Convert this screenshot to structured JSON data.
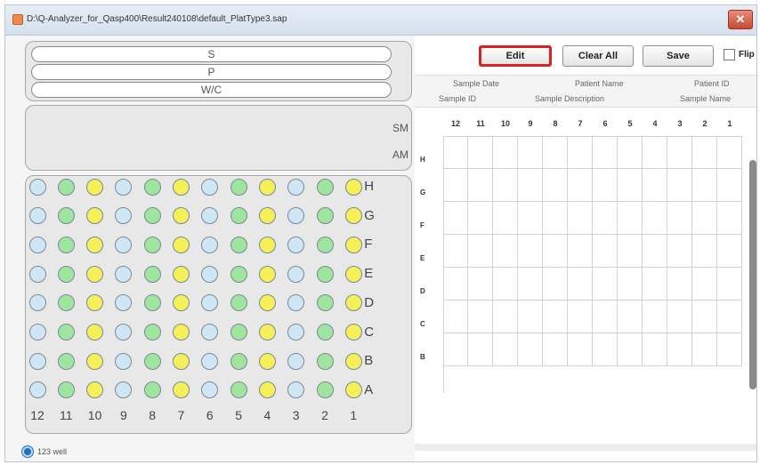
{
  "window": {
    "title": "D:\\Q-Analyzer_for_Qasp400\\Result240108\\default_PlatType3.sap",
    "close_glyph": "✕"
  },
  "left": {
    "spw_pills": [
      "S",
      "P",
      "W/C"
    ],
    "sm_label": "SM",
    "am_label": "AM",
    "plate": {
      "rows": [
        "H",
        "G",
        "F",
        "E",
        "D",
        "C",
        "B",
        "A"
      ],
      "columns": [
        "12",
        "11",
        "10",
        "9",
        "8",
        "7",
        "6",
        "5",
        "4",
        "3",
        "2",
        "1"
      ],
      "column_color_pattern": [
        "blue",
        "green",
        "yellow"
      ],
      "well_colors": {
        "blue": "#cfe7f5",
        "green": "#9fe5a0",
        "yellow": "#f5f05a"
      }
    },
    "mode_radio_label": "123 well"
  },
  "right": {
    "buttons": {
      "edit": "Edit",
      "clear_all": "Clear All",
      "save": "Save"
    },
    "flip_label": "Flip",
    "headers": {
      "sample_date": "Sample Date",
      "patient_name": "Patient Name",
      "patient_id": "Patient ID",
      "sample_id": "Sample ID",
      "sample_description": "Sample Description",
      "sample_name": "Sample Name"
    },
    "grid": {
      "columns": [
        "12",
        "11",
        "10",
        "9",
        "8",
        "7",
        "6",
        "5",
        "4",
        "3",
        "2",
        "1"
      ],
      "rows": [
        "H",
        "G",
        "F",
        "E",
        "D",
        "C",
        "B"
      ]
    }
  },
  "colors": {
    "edit_highlight": "#e02020",
    "radio_selected": "#1e6fc0",
    "close_button": "#c64a33"
  }
}
